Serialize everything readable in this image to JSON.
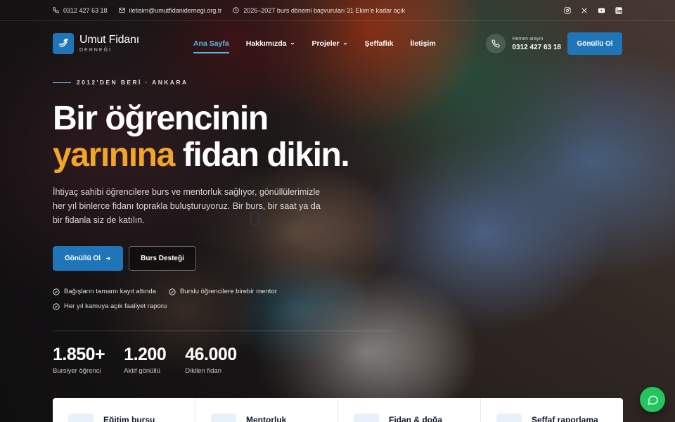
{
  "topbar": {
    "phone": "0312 427 63 18",
    "email": "iletisim@umutfidanidernegi.org.tr",
    "announcement": "2026–2027 burs dönemi başvuruları 31 Ekim'e kadar açık",
    "social": [
      "instagram-icon",
      "x-icon",
      "youtube-icon",
      "linkedin-icon"
    ]
  },
  "header": {
    "logo_name": "Umut Fidanı",
    "logo_sub": "DERNEĞİ",
    "nav": [
      {
        "label": "Ana Sayfa",
        "active": true
      },
      {
        "label": "Hakkımızda",
        "dropdown": true
      },
      {
        "label": "Projeler",
        "dropdown": true
      },
      {
        "label": "Şeffaflık"
      },
      {
        "label": "İletişim"
      }
    ],
    "call_label": "Hemen arayın",
    "call_number": "0312 427 63 18",
    "cta": "Gönüllü Ol"
  },
  "hero": {
    "eyebrow": "2012'DEN BERİ · ANKARA",
    "title_line1": "Bir öğrencinin",
    "title_accent": "yarınına",
    "title_rest": " fidan dikin.",
    "lead": "İhtiyaç sahibi öğrencilere burs ve mentorluk sağlıyor, gönüllülerimizle her yıl binlerce fidanı toprakla buluşturuyoruz. Bir burs, bir saat ya da bir fidanla siz de katılın.",
    "primary_button": "Gönüllü Ol",
    "secondary_button": "Burs Desteği",
    "checks": [
      "Bağışların tamamı kayıt altında",
      "Burslu öğrencilere birebir mentor",
      "Her yıl kamuya açık faaliyet raporu"
    ]
  },
  "stats": [
    {
      "value": "1.850+",
      "label": "Bursiyer öğrenci"
    },
    {
      "value": "1.200",
      "label": "Aktif gönüllü"
    },
    {
      "value": "46.000",
      "label": "Dikilen fidan"
    }
  ],
  "cards": [
    {
      "title": "Eğitim bursu"
    },
    {
      "title": "Mentorluk"
    },
    {
      "title": "Fidan & doğa"
    },
    {
      "title": "Şeffaf raporlama"
    }
  ],
  "colors": {
    "brand": "#1f75b8",
    "accent": "#f3a52a",
    "nav_active": "#5fb3ea",
    "chat": "#22c55e"
  }
}
